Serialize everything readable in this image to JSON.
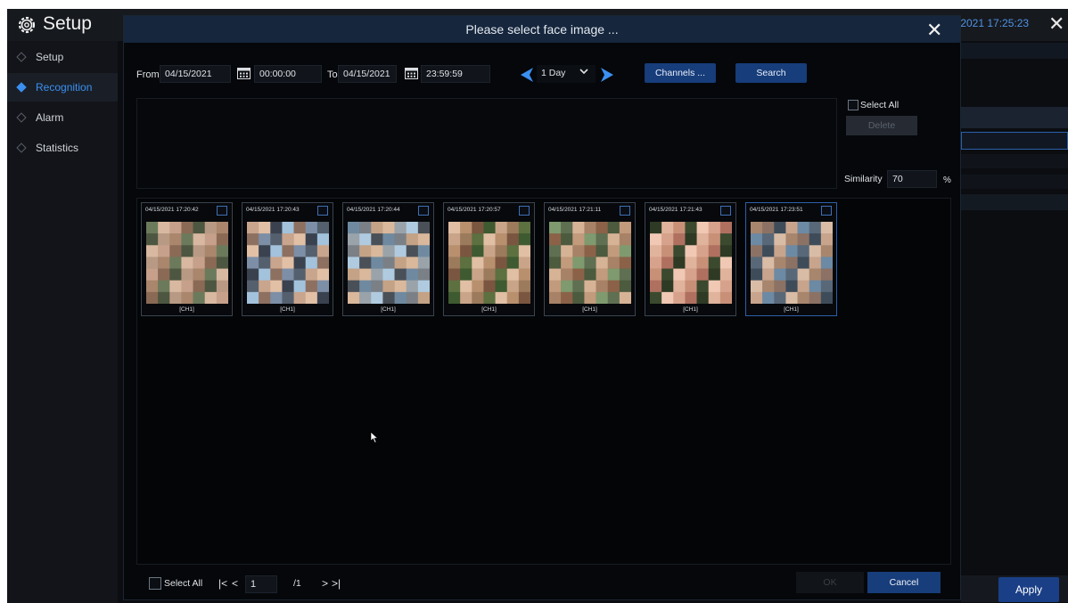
{
  "app": {
    "title": "Setup",
    "clock": "/2021 17:25:23",
    "close_glyph": "✕",
    "apply_label": "Apply"
  },
  "sidebar": {
    "items": [
      {
        "label": "Setup",
        "active": false
      },
      {
        "label": "Recognition",
        "active": true
      },
      {
        "label": "Alarm",
        "active": false
      },
      {
        "label": "Statistics",
        "active": false
      }
    ]
  },
  "modal": {
    "title": "Please select face image ...",
    "close_glyph": "✕",
    "from_label": "From",
    "from_date": "04/15/2021",
    "from_time": "00:00:00",
    "to_label": "To",
    "to_date": "04/15/2021",
    "to_time": "23:59:59",
    "period": "1 Day",
    "channels_label": "Channels ...",
    "search_label": "Search",
    "select_all_label": "Select All",
    "delete_label": "Delete",
    "similarity_label": "Similarity",
    "similarity_value": "70",
    "similarity_unit": "%",
    "results": [
      {
        "timestamp": "04/15/2021 17:20:42",
        "channel": "[CH1]"
      },
      {
        "timestamp": "04/15/2021 17:20:43",
        "channel": "[CH1]"
      },
      {
        "timestamp": "04/15/2021 17:20:44",
        "channel": "[CH1]"
      },
      {
        "timestamp": "04/15/2021 17:20:57",
        "channel": "[CH1]"
      },
      {
        "timestamp": "04/15/2021 17:21:11",
        "channel": "[CH1]"
      },
      {
        "timestamp": "04/15/2021 17:21:43",
        "channel": "[CH1]"
      },
      {
        "timestamp": "04/15/2021 17:23:51",
        "channel": "[CH1]"
      }
    ],
    "footer": {
      "select_all_label": "Select All",
      "first_glyph": "|<",
      "prev_glyph": "<",
      "page_value": "1",
      "page_total": "/1",
      "next_glyph": ">",
      "last_glyph": ">|",
      "ok_label": "OK",
      "cancel_label": "Cancel"
    }
  },
  "colors": {
    "accent": "#3b8ff0",
    "button": "#173d7a",
    "header": "#15263d"
  },
  "icons": [
    "gear-icon",
    "close-icon",
    "calendar-icon",
    "triangle-left-icon",
    "triangle-right-icon",
    "chevron-down-icon",
    "mouse-cursor-icon"
  ]
}
